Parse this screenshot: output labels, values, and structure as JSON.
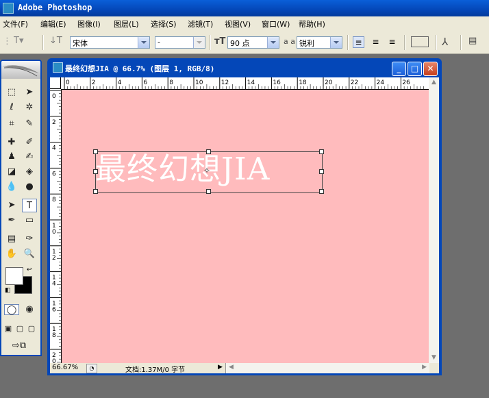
{
  "app": {
    "title": "Adobe Photoshop"
  },
  "menu": [
    "文件(F)",
    "编辑(E)",
    "图像(I)",
    "图层(L)",
    "选择(S)",
    "滤镜(T)",
    "视图(V)",
    "窗口(W)",
    "帮助(H)"
  ],
  "options": {
    "font_family": "宋体",
    "font_style": "-",
    "font_size": "90 点",
    "antialias_label": "a a",
    "antialias": "锐利"
  },
  "document": {
    "title": "最终幻想JIA @ 66.7% (图层 1, RGB/8)",
    "canvas_text": "最终幻想JIA",
    "canvas_color": "#ffbbbd",
    "zoom": "66.67%",
    "doc_info": "文档:1.37M/0 字节"
  },
  "rulers": {
    "top": [
      "0",
      "2",
      "4",
      "6",
      "8",
      "10",
      "12",
      "14",
      "16",
      "18",
      "20",
      "22",
      "24",
      "26"
    ],
    "left": [
      "0",
      "2",
      "4",
      "6",
      "8",
      "10",
      "12",
      "14",
      "16",
      "18",
      "20"
    ]
  },
  "colors": {
    "foreground": "#ffffff",
    "background": "#000000"
  }
}
